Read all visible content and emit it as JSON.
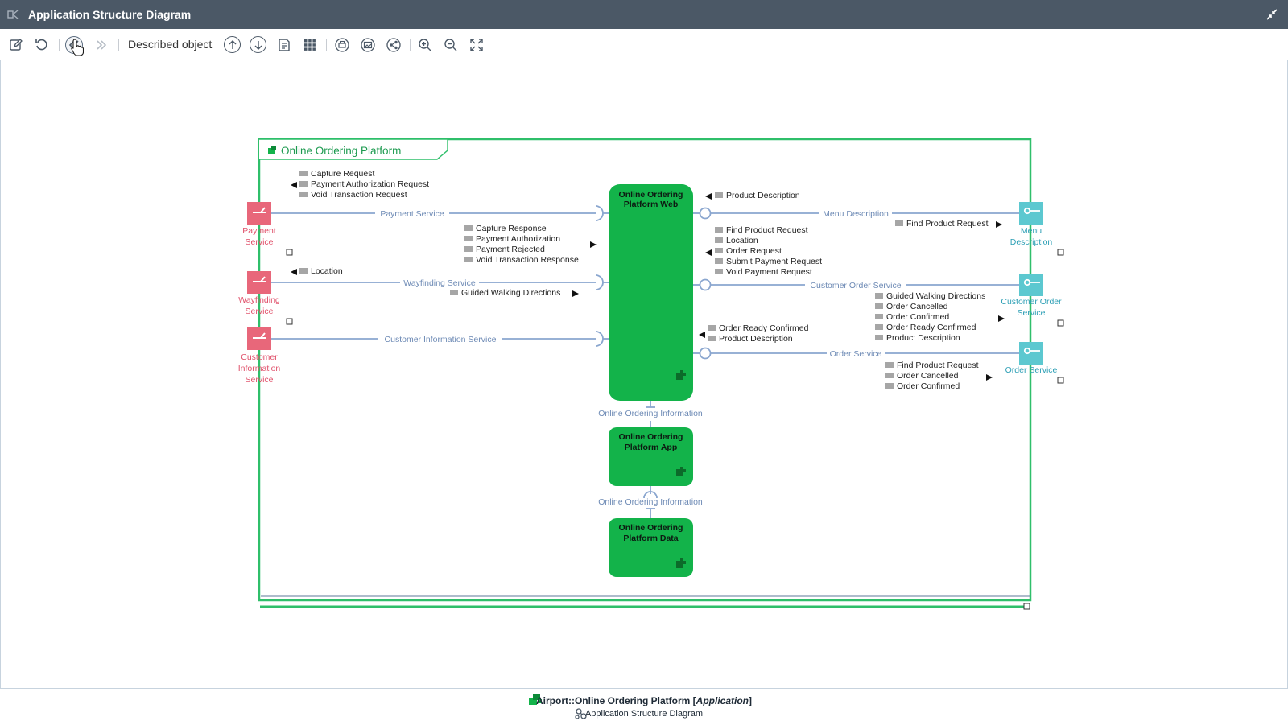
{
  "window": {
    "title": "Application Structure Diagram"
  },
  "toolbar": {
    "buttons": [
      "edit-icon",
      "refresh-icon",
      "back-icon",
      "forward-icon",
      "up-arrow-icon",
      "down-arrow-icon",
      "details-icon",
      "grid-icon",
      "print-icon",
      "image-icon",
      "share-icon",
      "zoom-in-icon",
      "zoom-out-icon",
      "fit-screen-icon"
    ],
    "described_object_label": "Described object"
  },
  "diagram": {
    "container_title": "Online Ordering Platform",
    "components": [
      {
        "line1": "Online Ordering",
        "line2": "Platform Web"
      },
      {
        "line1": "Online Ordering",
        "line2": "Platform App"
      },
      {
        "line1": "Online Ordering",
        "line2": "Platform Data"
      }
    ],
    "connector_labels": [
      "Online Ordering Information",
      "Online Ordering Information"
    ],
    "left_ports": [
      {
        "lines": [
          "Payment",
          "Service"
        ],
        "connector": "Payment Service"
      },
      {
        "lines": [
          "Wayfinding",
          "Service"
        ],
        "connector": "Wayfinding Service"
      },
      {
        "lines": [
          "Customer",
          "Information",
          "Service"
        ],
        "connector": "Customer Information Service"
      }
    ],
    "right_ports": [
      {
        "lines": [
          "Menu",
          "Description"
        ],
        "connector": "Menu Description"
      },
      {
        "lines": [
          "Customer Order",
          "Service"
        ],
        "connector": "Customer Order Service"
      },
      {
        "lines": [
          "Order Service"
        ],
        "connector": "Order Service"
      }
    ],
    "messages": {
      "payment_in": [
        "Capture Request",
        "Payment Authorization Request",
        "Void Transaction Request"
      ],
      "payment_out": [
        "Capture Response",
        "Payment Authorization",
        "Payment Rejected",
        "Void Transaction Response"
      ],
      "wayfinding_in": [
        "Location"
      ],
      "wayfinding_out": [
        "Guided Walking Directions"
      ],
      "menu_in": [
        "Product Description"
      ],
      "menu_out": [
        "Find Product Request"
      ],
      "customer_order_in": [
        "Find Product Request",
        "Location",
        "Order Request",
        "Submit Payment Request",
        "Void Payment Request"
      ],
      "customer_order_out": [
        "Guided Walking Directions",
        "Order Cancelled",
        "Order Confirmed",
        "Order Ready Confirmed",
        "Product Description"
      ],
      "order_in": [
        "Order Ready Confirmed",
        "Product Description"
      ],
      "order_out": [
        "Find Product Request",
        "Order Cancelled",
        "Order Confirmed"
      ]
    }
  },
  "footer": {
    "context_path": "Airport::Online Ordering Platform [",
    "context_type": "Application",
    "context_close": "]",
    "diagram_type": "Application Structure Diagram"
  },
  "colors": {
    "titlebar": "#4b5866",
    "container_border": "#2fbf6a",
    "component_fill": "#13b34a",
    "required_port": "#e8677a",
    "provided_port": "#5cc8d0",
    "connector": "#8aa6cf"
  }
}
